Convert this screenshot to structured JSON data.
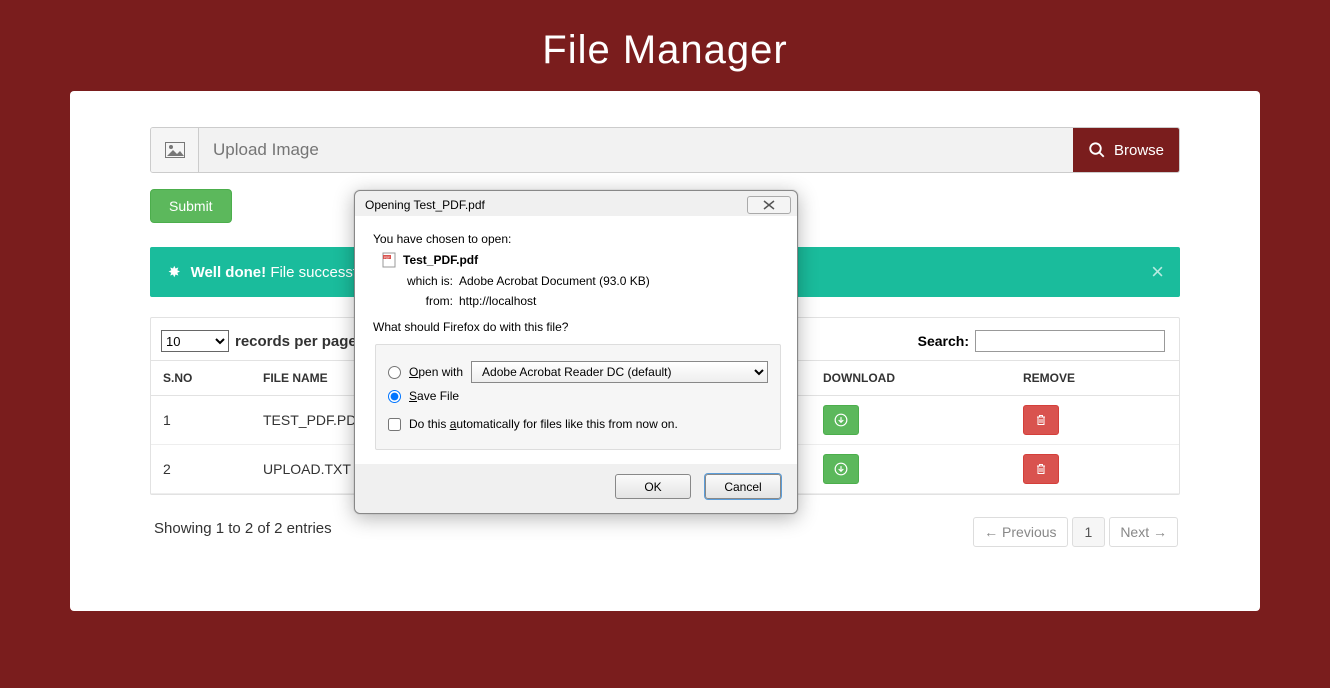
{
  "title": "File Manager",
  "upload": {
    "placeholder": "Upload Image",
    "browse": "Browse",
    "submit": "Submit"
  },
  "alert": {
    "strong": "Well done!",
    "text": "File successfull"
  },
  "records": {
    "select_value": "10",
    "label": "records per page"
  },
  "search": {
    "label": "Search:"
  },
  "columns": {
    "c1": "S.NO",
    "c2": "FILE NAME",
    "c3": "DOWNLOAD",
    "c4": "REMOVE"
  },
  "rows": [
    {
      "sno": "1",
      "name": "TEST_PDF.PDF"
    },
    {
      "sno": "2",
      "name": "UPLOAD.TXT"
    }
  ],
  "entries_info": "Showing 1 to 2 of 2 entries",
  "pager": {
    "prev": "← Previous",
    "current": "1",
    "next": "Next →"
  },
  "dialog": {
    "title": "Opening Test_PDF.pdf",
    "chosen": "You have chosen to open:",
    "filename": "Test_PDF.pdf",
    "which_is_k": "which is:",
    "which_is_v": "Adobe Acrobat Document (93.0 KB)",
    "from_k": "from:",
    "from_v": "http://localhost",
    "question": "What should Firefox do with this file?",
    "open_with": "Open with",
    "open_app": "Adobe Acrobat Reader DC  (default)",
    "save_file": "Save File",
    "auto": "Do this automatically for files like this from now on.",
    "ok": "OK",
    "cancel": "Cancel"
  }
}
